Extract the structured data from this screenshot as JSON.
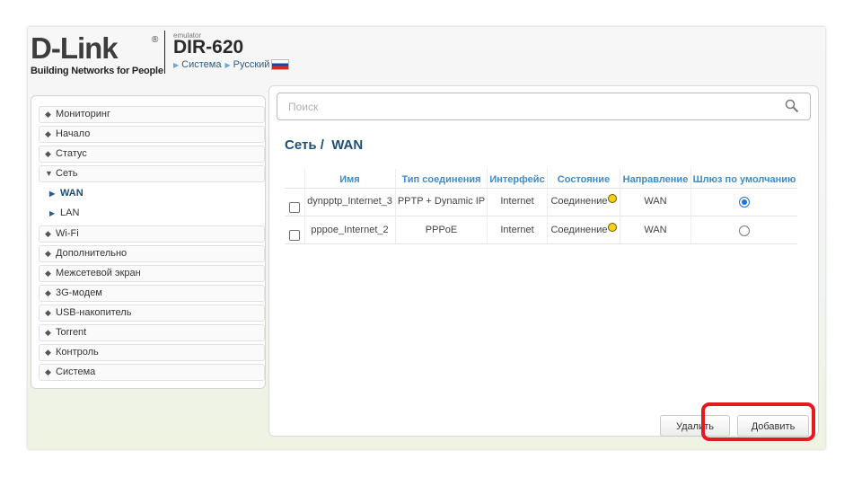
{
  "header": {
    "brand": "D-Link",
    "brand_reg": "®",
    "tagline": "Building Networks for People",
    "model_caption": "emulator",
    "model": "DIR-620",
    "crumb_system": "Система",
    "crumb_language": "Русский"
  },
  "sidebar": {
    "items": [
      {
        "label": "Мониторинг"
      },
      {
        "label": "Начало"
      },
      {
        "label": "Статус"
      },
      {
        "label": "Сеть"
      },
      {
        "label": "Wi-Fi"
      },
      {
        "label": "Дополнительно"
      },
      {
        "label": "Межсетевой экран"
      },
      {
        "label": "3G-модем"
      },
      {
        "label": "USB-накопитель"
      },
      {
        "label": "Torrent"
      },
      {
        "label": "Контроль"
      },
      {
        "label": "Система"
      }
    ],
    "subitems": [
      {
        "label": "WAN"
      },
      {
        "label": "LAN"
      }
    ]
  },
  "search": {
    "placeholder": "Поиск"
  },
  "page": {
    "title": "Сеть /  WAN"
  },
  "table": {
    "headers": [
      "Имя",
      "Тип соединения",
      "Интерфейс",
      "Состояние",
      "Направление",
      "Шлюз по умолчанию"
    ],
    "rows": [
      {
        "name": "dynpptp_Internet_3",
        "type": "PPTP + Dynamic IP",
        "interface": "Internet",
        "state": "Соединение",
        "direction": "WAN",
        "default_gw": true
      },
      {
        "name": "pppoe_Internet_2",
        "type": "PPPoE",
        "interface": "Internet",
        "state": "Соединение",
        "direction": "WAN",
        "default_gw": false
      }
    ]
  },
  "buttons": {
    "delete": "Удалить",
    "add": "Добавить"
  },
  "colors": {
    "accent": "#3c8ccb",
    "title": "#1f4e79",
    "highlight": "#e01b22",
    "status_dot": "#f5d11a"
  }
}
